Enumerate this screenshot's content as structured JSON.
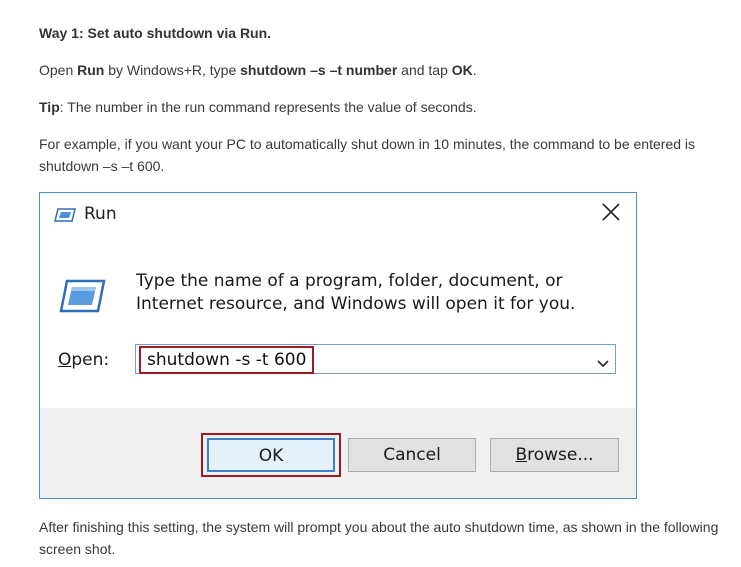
{
  "article": {
    "heading": "Way 1: Set auto shutdown via Run.",
    "open_line": {
      "t1": "Open ",
      "b1": "Run",
      "t2": " by Windows+R, type ",
      "b2": "shutdown –s –t number",
      "t3": " and tap ",
      "b3": "OK",
      "t4": "."
    },
    "tip_line": {
      "label": "Tip",
      "text": ": The number in the run command represents the value of seconds."
    },
    "example": "For example, if you want your PC to automatically shut down in 10 minutes, the command to be entered is shutdown –s –t 600.",
    "after": "After finishing this setting, the system will prompt you about the auto shutdown time, as shown in the following screen shot."
  },
  "dialog": {
    "title": "Run",
    "description": "Type the name of a program, folder, document, or Internet resource, and Windows will open it for you.",
    "open_label_ul": "O",
    "open_label_rest": "pen:",
    "command_value": "shutdown -s -t 600",
    "ok_label": "OK",
    "cancel_label": "Cancel",
    "browse_ul": "B",
    "browse_rest": "rowse...",
    "icons": {
      "title": "run-icon",
      "large": "run-icon",
      "close": "close-icon",
      "dropdown": "chevron-down-icon"
    },
    "colors": {
      "highlight": "#a01820",
      "border_blue": "#4a8fd6",
      "footer": "#f0f0f0"
    }
  }
}
